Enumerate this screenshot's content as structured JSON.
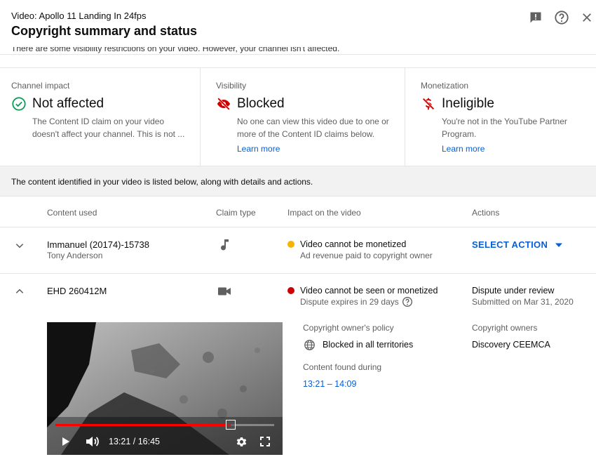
{
  "header": {
    "video_label": "Video: Apollo 11 Landing In 24fps",
    "title": "Copyright summary and status",
    "clipped_notice": "There are some visibility restrictions on your video. However, your channel isn't affected."
  },
  "summary": {
    "channel": {
      "heading": "Channel impact",
      "status": "Not affected",
      "desc": "The Content ID claim on your video doesn't affect your channel. This is not ..."
    },
    "visibility": {
      "heading": "Visibility",
      "status": "Blocked",
      "desc": "No one can view this video due to one or more of the Content ID claims below.",
      "link": "Learn more"
    },
    "monetization": {
      "heading": "Monetization",
      "status": "Ineligible",
      "desc": "You're not in the YouTube Partner Program.",
      "link": "Learn more"
    }
  },
  "info_bar": "The content identified in your video is listed below, along with details and actions.",
  "table": {
    "headers": {
      "content": "Content used",
      "claim": "Claim type",
      "impact": "Impact on the video",
      "actions": "Actions"
    },
    "rows": [
      {
        "title": "Immanuel (20174)-15738",
        "subtitle": "Tony Anderson",
        "claim_icon": "music-note-icon",
        "impact_title": "Video cannot be monetized",
        "impact_sub": "Ad revenue paid to copyright owner",
        "impact_color": "#f4b400",
        "action": "SELECT ACTION"
      },
      {
        "title": "EHD 260412M",
        "claim_icon": "video-camera-icon",
        "impact_title": "Video cannot be seen or monetized",
        "impact_sub": "Dispute expires in 29 days",
        "impact_color": "#cc0000",
        "action_title": "Dispute under review",
        "action_sub": "Submitted on Mar 31, 2020"
      }
    ]
  },
  "details": {
    "policy_label": "Copyright owner's policy",
    "policy_value": "Blocked in all territories",
    "found_label": "Content found during",
    "found_value": "13:21 – 14:09",
    "owners_label": "Copyright owners",
    "owners_value": "Discovery CEEMCA"
  },
  "player": {
    "time": "13:21 / 16:45",
    "progress": 0.8
  },
  "colors": {
    "accent": "#065fd4",
    "success": "#0f9d58",
    "blocked": "#cc0000",
    "warning": "#f4b400"
  }
}
